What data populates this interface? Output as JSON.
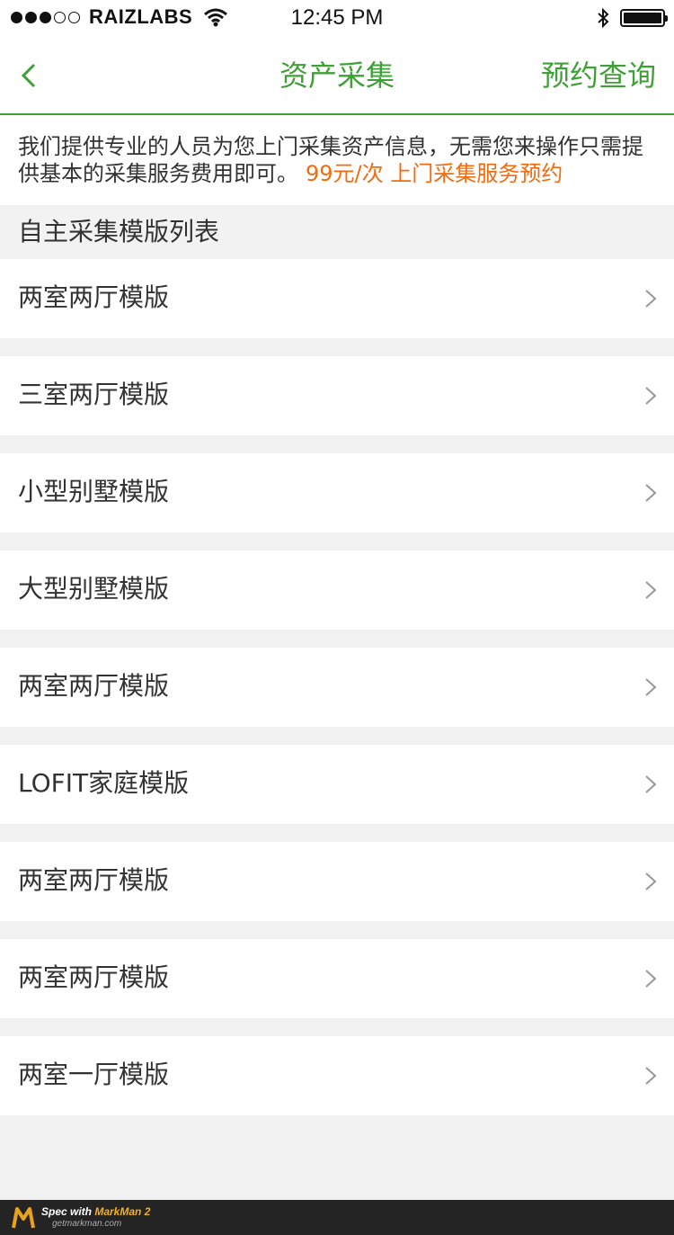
{
  "status_bar": {
    "signal_dots_filled": 3,
    "signal_dots_total": 5,
    "carrier": "RAIZLABS",
    "time": "12:45 PM",
    "icons": [
      "wifi-icon",
      "bluetooth-icon",
      "battery-icon"
    ]
  },
  "nav": {
    "title": "资产采集",
    "right_action": "预约查询",
    "accent_color": "#3fa037"
  },
  "intro": {
    "text": "我们提供专业的人员为您上门采集资产信息，无需您来操作只需提供基本的采集服务费用即可。",
    "price_link": "99元/次 上门采集服务预约",
    "text_color": "#323232",
    "link_color": "#f46a0c"
  },
  "section": {
    "title": "自主采集模版列表"
  },
  "templates": [
    {
      "label": "两室两厅模版"
    },
    {
      "label": "三室两厅模版"
    },
    {
      "label": "小型别墅模版"
    },
    {
      "label": "大型别墅模版"
    },
    {
      "label": "两室两厅模版"
    },
    {
      "label": "LOFIT家庭模版"
    },
    {
      "label": "两室两厅模版"
    },
    {
      "label": "两室两厅模版"
    },
    {
      "label": "两室一厅模版"
    }
  ],
  "footer": {
    "brand_prefix": "Spec with ",
    "brand_name": "MarkMan 2",
    "site": "getmarkman.com"
  }
}
